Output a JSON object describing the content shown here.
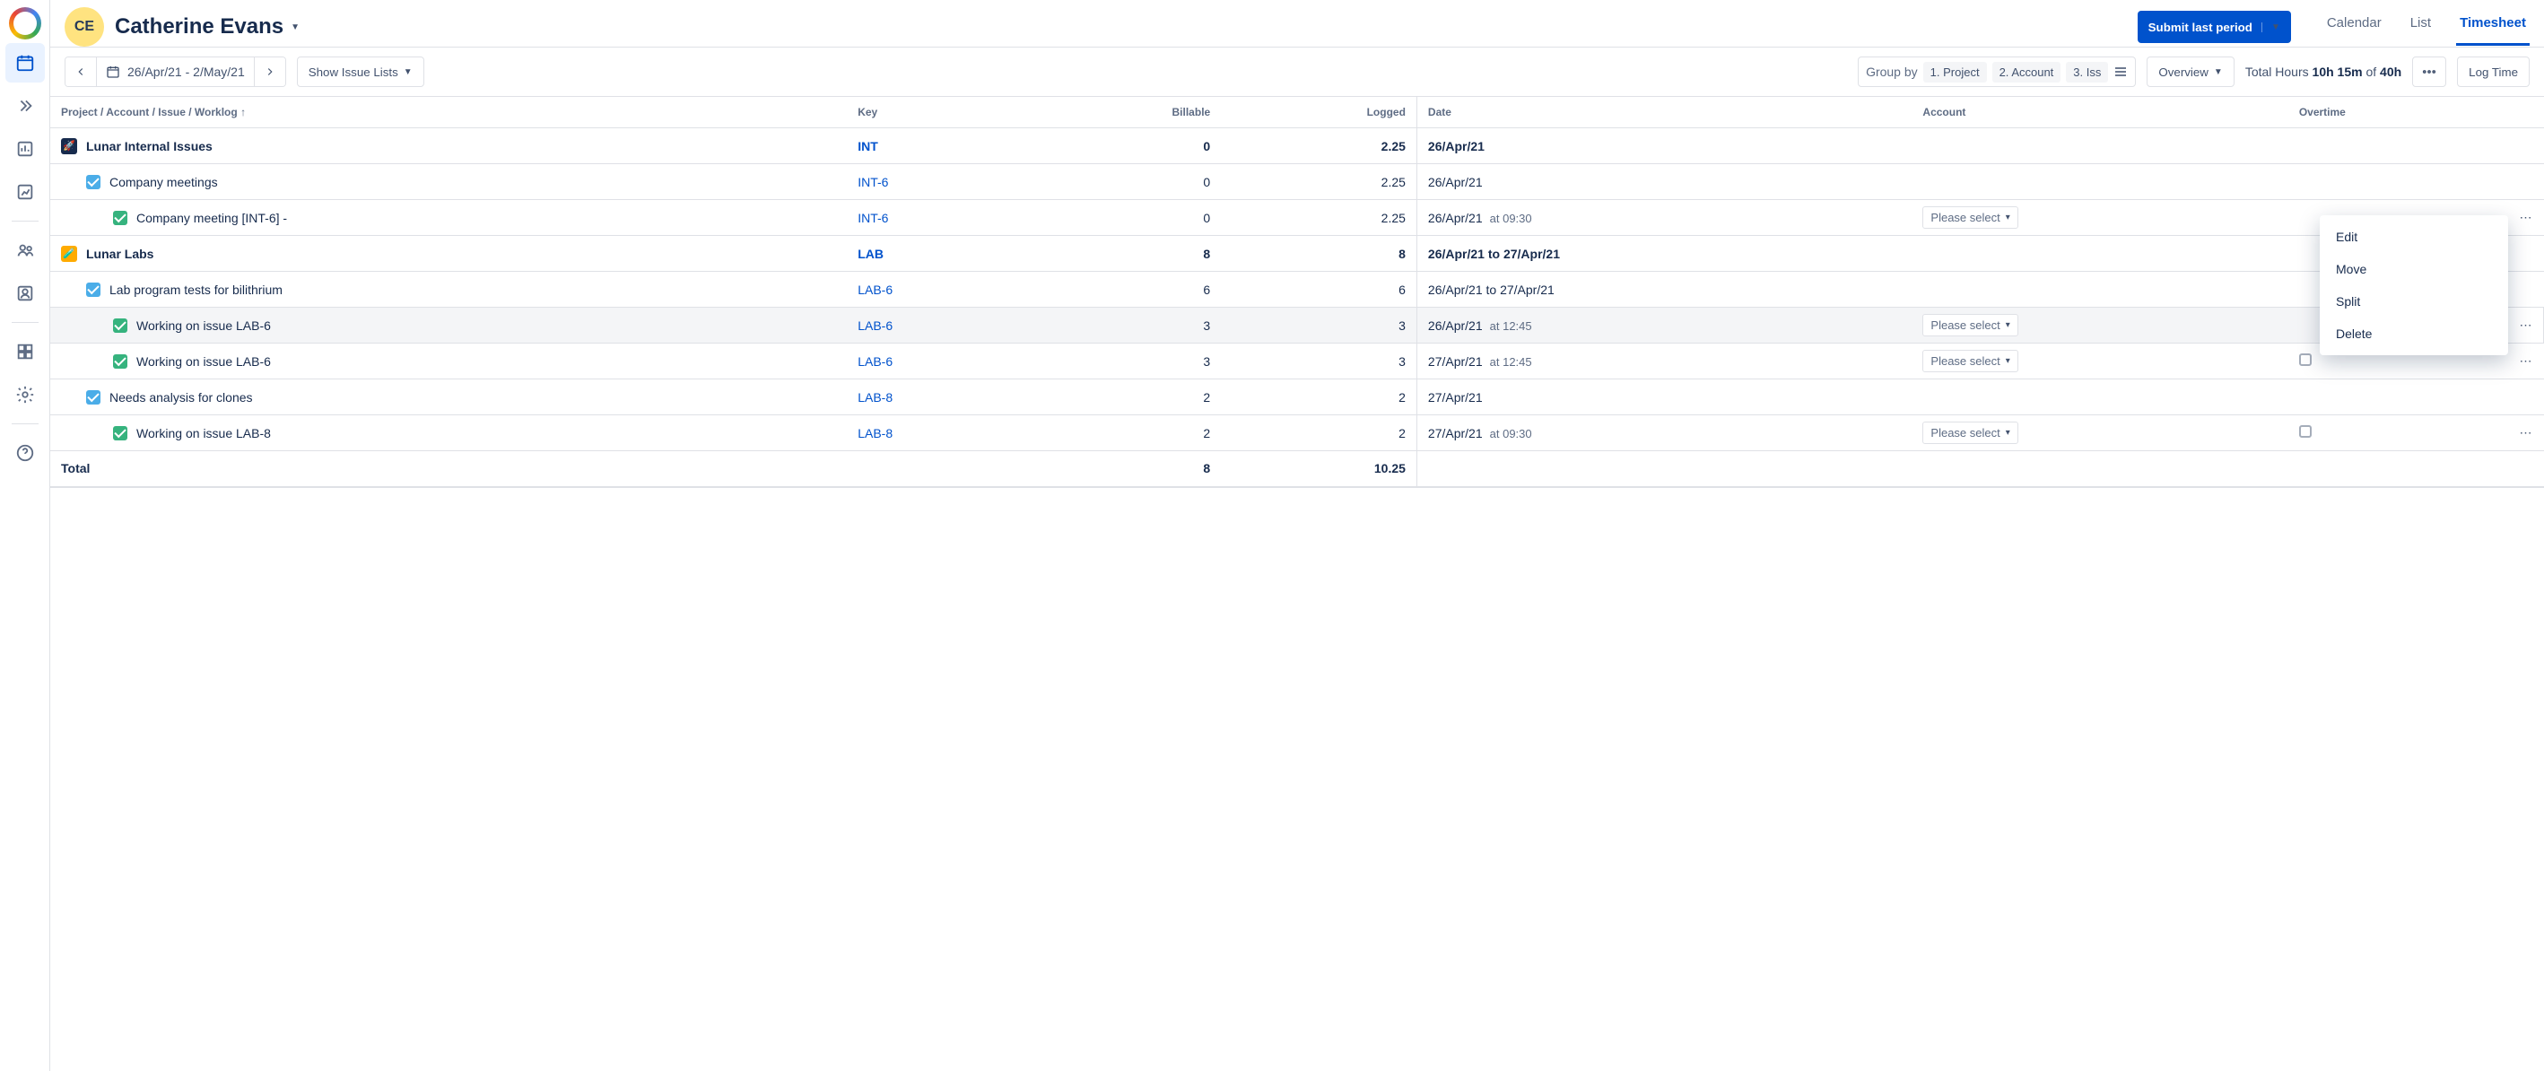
{
  "user": {
    "initials": "CE",
    "name": "Catherine Evans"
  },
  "header_actions": {
    "submit_label": "Submit last period",
    "tabs": {
      "calendar": "Calendar",
      "list": "List",
      "timesheet": "Timesheet"
    }
  },
  "toolbar": {
    "date_range": "26/Apr/21 - 2/May/21",
    "show_lists": "Show Issue Lists",
    "group_by_label": "Group by",
    "group_chips": {
      "c1": "1. Project",
      "c2": "2. Account",
      "c3": "3. Iss"
    },
    "overview": "Overview",
    "total_hours_label": "Total Hours",
    "total_hours_value": "10h 15m",
    "total_hours_of": "of",
    "total_hours_capacity": "40h",
    "log_time": "Log Time"
  },
  "columns": {
    "path": "Project / Account / Issue / Worklog",
    "key": "Key",
    "billable": "Billable",
    "logged": "Logged",
    "date": "Date",
    "account": "Account",
    "overtime": "Overtime"
  },
  "select_placeholder": "Please select",
  "context_menu": {
    "edit": "Edit",
    "move": "Move",
    "split": "Split",
    "delete": "Delete"
  },
  "rows": {
    "p1": {
      "title": "Lunar Internal Issues",
      "key": "INT",
      "billable": "0",
      "logged": "2.25",
      "date": "26/Apr/21"
    },
    "p1i1": {
      "title": "Company meetings",
      "key": "INT-6",
      "billable": "0",
      "logged": "2.25",
      "date": "26/Apr/21"
    },
    "p1w1": {
      "title": "Company meeting [INT-6] -",
      "key": "INT-6",
      "billable": "0",
      "logged": "2.25",
      "date": "26/Apr/21",
      "time": "at 09:30"
    },
    "p2": {
      "title": "Lunar Labs",
      "key": "LAB",
      "billable": "8",
      "logged": "8",
      "date": "26/Apr/21 to 27/Apr/21"
    },
    "p2i1": {
      "title": "Lab program tests for bilithrium",
      "key": "LAB-6",
      "billable": "6",
      "logged": "6",
      "date": "26/Apr/21 to 27/Apr/21"
    },
    "p2w1": {
      "title": "Working on issue LAB-6",
      "key": "LAB-6",
      "billable": "3",
      "logged": "3",
      "date": "26/Apr/21",
      "time": "at 12:45"
    },
    "p2w2": {
      "title": "Working on issue LAB-6",
      "key": "LAB-6",
      "billable": "3",
      "logged": "3",
      "date": "27/Apr/21",
      "time": "at 12:45"
    },
    "p2i2": {
      "title": "Needs analysis for clones",
      "key": "LAB-8",
      "billable": "2",
      "logged": "2",
      "date": "27/Apr/21"
    },
    "p2w3": {
      "title": "Working on issue LAB-8",
      "key": "LAB-8",
      "billable": "2",
      "logged": "2",
      "date": "27/Apr/21",
      "time": "at 09:30"
    }
  },
  "footer": {
    "label": "Total",
    "billable": "8",
    "logged": "10.25"
  }
}
